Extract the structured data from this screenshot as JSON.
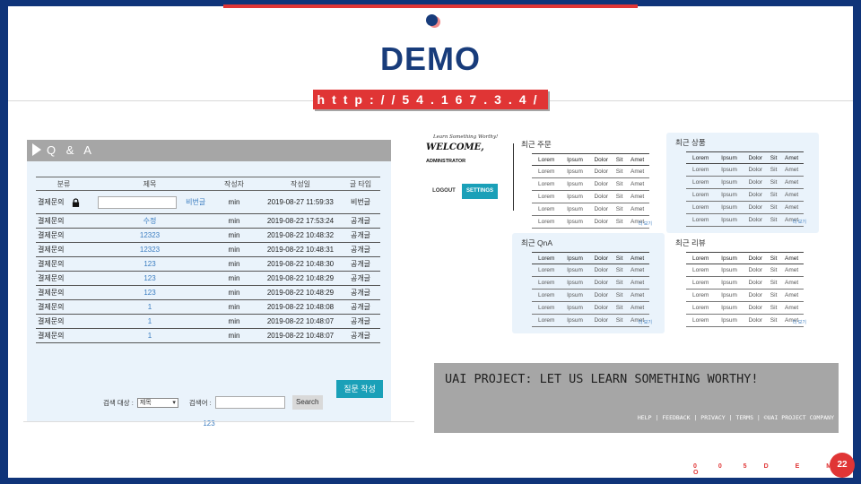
{
  "slide": {
    "title": "DEMO",
    "url": "http://54.167.3.4/",
    "section_number": "0 0 5",
    "section_name": "D E M O",
    "page_number": "22",
    "colors": {
      "accent": "#e03535",
      "navy": "#183c7b",
      "teal": "#1aa0b8",
      "panel": "#eaf3fb"
    }
  },
  "qa": {
    "header": "Q & A",
    "columns": [
      "분류",
      "제목",
      "작성자",
      "작성일",
      "글 타입"
    ],
    "password_row": {
      "category": "결제문의",
      "password_link": "비번글",
      "author": "min",
      "date": "2019-08-27 11:59:33",
      "type": "비번글"
    },
    "rows": [
      {
        "category": "결제문의",
        "title": "수정",
        "author": "min",
        "date": "2019-08-22 17:53:24",
        "type": "공개글"
      },
      {
        "category": "결제문의",
        "title": "12323",
        "author": "min",
        "date": "2019-08-22 10:48:32",
        "type": "공개글"
      },
      {
        "category": "결제문의",
        "title": "12323",
        "author": "min",
        "date": "2019-08-22 10:48:31",
        "type": "공개글"
      },
      {
        "category": "결제문의",
        "title": "123",
        "author": "min",
        "date": "2019-08-22 10:48:30",
        "type": "공개글"
      },
      {
        "category": "결제문의",
        "title": "123",
        "author": "min",
        "date": "2019-08-22 10:48:29",
        "type": "공개글"
      },
      {
        "category": "결제문의",
        "title": "123",
        "author": "min",
        "date": "2019-08-22 10:48:29",
        "type": "공개글"
      },
      {
        "category": "결제문의",
        "title": "1",
        "author": "min",
        "date": "2019-08-22 10:48:08",
        "type": "공개글"
      },
      {
        "category": "결제문의",
        "title": "1",
        "author": "min",
        "date": "2019-08-22 10:48:07",
        "type": "공개글"
      },
      {
        "category": "결제문의",
        "title": "1",
        "author": "min",
        "date": "2019-08-22 10:48:07",
        "type": "공개글"
      }
    ],
    "ask_button": "질문 작성",
    "search_target_label": "검색 대상 :",
    "search_target_value": "제목",
    "search_keyword_label": "검색어 :",
    "search_button": "Search",
    "pager": "123"
  },
  "admin": {
    "subtitle": "Learn Something Worthy!",
    "welcome": "WELCOME,",
    "role": "ADMINSTRATOR",
    "logout_button": "LOGOUT",
    "settings_button": "SETTINGS"
  },
  "mini_panels": {
    "columns": [
      "Lorem",
      "Ipsum",
      "Dolor",
      "Sit",
      "Amet"
    ],
    "cells": [
      "Lorem",
      "Ipsum",
      "Dolor",
      "Sit",
      "Amet"
    ],
    "more": "더 보기",
    "recent_orders": "최근 주문",
    "recent_products": "최근 상품",
    "recent_qna": "최근 QnA",
    "recent_reviews": "최근 리뷰"
  },
  "banner": {
    "title": "UAI PROJECT: LET US LEARN SOMETHING WORTHY!",
    "links": "HELP | FEEDBACK | PRIVACY | TERMS | ©UAI PROJECT COMPANY"
  }
}
